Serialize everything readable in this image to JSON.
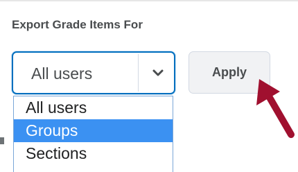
{
  "section": {
    "label": "Export Grade Items For"
  },
  "user_filter": {
    "selected_value": "All users",
    "options": [
      {
        "label": "All users",
        "selected": false
      },
      {
        "label": "Groups",
        "selected": true
      },
      {
        "label": "Sections",
        "selected": false
      }
    ]
  },
  "apply_button": {
    "label": "Apply"
  },
  "icons": {
    "dropdown": "chevron-down-icon",
    "annotation": "pointer-arrow-icon"
  },
  "colors": {
    "select_border": "#006fbf",
    "option_highlight": "#3b91f2",
    "annotation_arrow": "#a0102f",
    "button_bg": "#f1f2f4",
    "label_text": "#494c4e"
  }
}
